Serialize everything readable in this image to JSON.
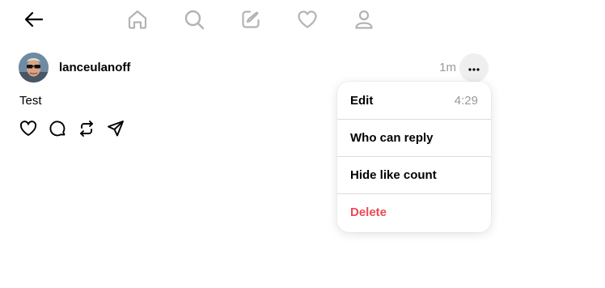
{
  "nav": {
    "icons": [
      "back-arrow-icon",
      "home-icon",
      "search-icon",
      "compose-icon",
      "heart-icon",
      "profile-icon"
    ]
  },
  "post": {
    "username": "lanceulanoff",
    "time_ago": "1m",
    "text": "Test",
    "more_icon": "ellipsis-icon",
    "actions": [
      "like-icon",
      "reply-icon",
      "repost-icon",
      "share-icon"
    ]
  },
  "menu": {
    "items": [
      {
        "label": "Edit",
        "hint": "4:29"
      },
      {
        "label": "Who can reply"
      },
      {
        "label": "Hide like count"
      },
      {
        "label": "Delete"
      }
    ]
  },
  "colors": {
    "text": "#000000",
    "muted": "#999999",
    "nav_icon": "#b3b3b3",
    "danger": "#ed4956",
    "menu_divider": "#dbdbdb",
    "more_button_bg": "#efefef"
  }
}
